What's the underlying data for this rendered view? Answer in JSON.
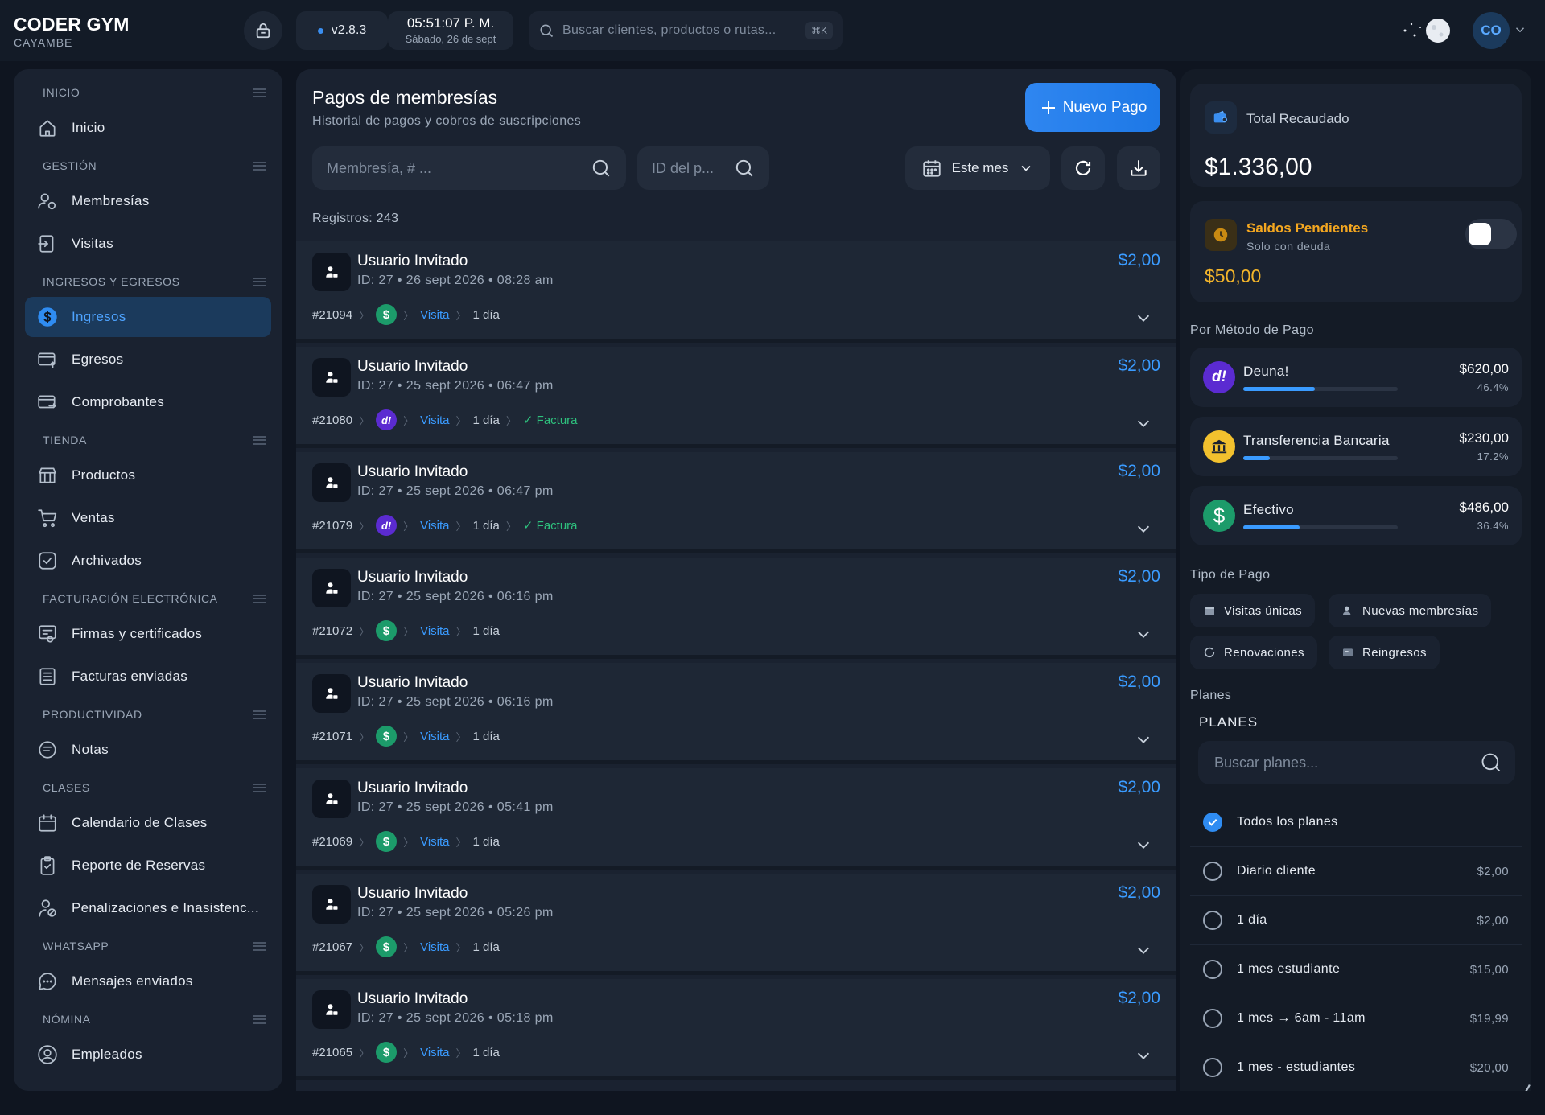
{
  "brand": {
    "name": "CODER GYM",
    "location": "CAYAMBE"
  },
  "topbar": {
    "version": "v2.8.3",
    "time": "05:51:07 P. M.",
    "date": "Sábado, 26 de sept",
    "search_placeholder": "Buscar clientes, productos o rutas...",
    "shortcut": "⌘K",
    "avatar_initials": "CO"
  },
  "sidebar": {
    "sections": [
      {
        "title": "INICIO",
        "items": [
          {
            "label": "Inicio",
            "icon": "home-icon"
          }
        ]
      },
      {
        "title": "GESTIÓN",
        "items": [
          {
            "label": "Membresías",
            "icon": "users-icon"
          },
          {
            "label": "Visitas",
            "icon": "login-icon"
          }
        ]
      },
      {
        "title": "INGRESOS Y EGRESOS",
        "items": [
          {
            "label": "Ingresos",
            "icon": "dollar-circle-icon",
            "active": true
          },
          {
            "label": "Egresos",
            "icon": "card-out-icon"
          },
          {
            "label": "Comprobantes",
            "icon": "card-swap-icon"
          }
        ]
      },
      {
        "title": "TIENDA",
        "items": [
          {
            "label": "Productos",
            "icon": "store-icon"
          },
          {
            "label": "Ventas",
            "icon": "cart-icon"
          },
          {
            "label": "Archivados",
            "icon": "archive-check-icon"
          }
        ]
      },
      {
        "title": "FACTURACIÓN ELECTRÓNICA",
        "items": [
          {
            "label": "Firmas y certificados",
            "icon": "certificate-icon"
          },
          {
            "label": "Facturas enviadas",
            "icon": "list-doc-icon"
          }
        ]
      },
      {
        "title": "PRODUCTIVIDAD",
        "items": [
          {
            "label": "Notas",
            "icon": "notes-icon"
          }
        ]
      },
      {
        "title": "CLASES",
        "items": [
          {
            "label": "Calendario de Clases",
            "icon": "calendar-icon"
          },
          {
            "label": "Reporte de Reservas",
            "icon": "clipboard-check-icon"
          },
          {
            "label": "Penalizaciones e Inasistenc...",
            "icon": "user-block-icon"
          }
        ]
      },
      {
        "title": "WHATSAPP",
        "items": [
          {
            "label": "Mensajes enviados",
            "icon": "chat-icon"
          }
        ]
      },
      {
        "title": "NÓMINA",
        "items": [
          {
            "label": "Empleados",
            "icon": "user-circle-icon"
          }
        ]
      }
    ]
  },
  "main": {
    "title": "Pagos de membresías",
    "subtitle": "Historial de pagos y cobros de suscripciones",
    "new_button": "Nuevo Pago",
    "filter_membership_placeholder": "Membresía, # ...",
    "filter_id_placeholder": "ID del p...",
    "period": "Este mes",
    "records": "Registros: 243",
    "rows": [
      {
        "name": "Usuario Invitado",
        "meta": "ID: 27 • 26 sept 2026 • 08:28 am",
        "amount": "$2,00",
        "code": "#21094",
        "method": "cash",
        "type": "Visita",
        "plan": "1 día",
        "invoice": ""
      },
      {
        "name": "Usuario Invitado",
        "meta": "ID: 27 • 25 sept 2026 • 06:47 pm",
        "amount": "$2,00",
        "code": "#21080",
        "method": "deuna",
        "type": "Visita",
        "plan": "1 día",
        "invoice": "✓ Factura"
      },
      {
        "name": "Usuario Invitado",
        "meta": "ID: 27 • 25 sept 2026 • 06:47 pm",
        "amount": "$2,00",
        "code": "#21079",
        "method": "deuna",
        "type": "Visita",
        "plan": "1 día",
        "invoice": "✓ Factura"
      },
      {
        "name": "Usuario Invitado",
        "meta": "ID: 27 • 25 sept 2026 • 06:16 pm",
        "amount": "$2,00",
        "code": "#21072",
        "method": "cash",
        "type": "Visita",
        "plan": "1 día",
        "invoice": ""
      },
      {
        "name": "Usuario Invitado",
        "meta": "ID: 27 • 25 sept 2026 • 06:16 pm",
        "amount": "$2,00",
        "code": "#21071",
        "method": "cash",
        "type": "Visita",
        "plan": "1 día",
        "invoice": ""
      },
      {
        "name": "Usuario Invitado",
        "meta": "ID: 27 • 25 sept 2026 • 05:41 pm",
        "amount": "$2,00",
        "code": "#21069",
        "method": "cash",
        "type": "Visita",
        "plan": "1 día",
        "invoice": ""
      },
      {
        "name": "Usuario Invitado",
        "meta": "ID: 27 • 25 sept 2026 • 05:26 pm",
        "amount": "$2,00",
        "code": "#21067",
        "method": "cash",
        "type": "Visita",
        "plan": "1 día",
        "invoice": ""
      },
      {
        "name": "Usuario Invitado",
        "meta": "ID: 27 • 25 sept 2026 • 05:18 pm",
        "amount": "$2,00",
        "code": "#21065",
        "method": "cash",
        "type": "Visita",
        "plan": "1 día",
        "invoice": ""
      }
    ]
  },
  "summary": {
    "total_label": "Total Recaudado",
    "total_value": "$1.336,00",
    "pending_label": "Saldos Pendientes",
    "pending_sub": "Solo con deuda",
    "pending_value": "$50,00",
    "pending_toggle_on": false,
    "by_method_title": "Por Método de Pago",
    "methods": [
      {
        "name": "Deuna!",
        "amount": "$620,00",
        "percent": "46.4%",
        "share": 0.464,
        "logo": "d!",
        "color": "#5b2bd1"
      },
      {
        "name": "Transferencia Bancaria",
        "amount": "$230,00",
        "percent": "17.2%",
        "share": 0.172,
        "logo": "bank-icon",
        "color": "#f2c12e"
      },
      {
        "name": "Efectivo",
        "amount": "$486,00",
        "percent": "36.4%",
        "share": 0.364,
        "logo": "$",
        "color": "#1c9b6a"
      }
    ],
    "type_title": "Tipo de Pago",
    "types": [
      "Visitas únicas",
      "Nuevas membresías",
      "Renovaciones",
      "Reingresos"
    ],
    "plans_title": "Planes",
    "plans_header": "PLANES",
    "plans_search_placeholder": "Buscar planes...",
    "plans": [
      {
        "name": "Todos los planes",
        "price": "",
        "checked": true
      },
      {
        "name": "Diario cliente",
        "price": "$2,00",
        "checked": false
      },
      {
        "name": "1 día",
        "price": "$2,00",
        "checked": false
      },
      {
        "name": "1 mes estudiante",
        "price": "$15,00",
        "checked": false
      },
      {
        "name": "1 mes → 6am - 11am",
        "price": "$19,99",
        "checked": false
      },
      {
        "name": "1 mes - estudiantes",
        "price": "$20,00",
        "checked": false
      }
    ]
  },
  "colors": {
    "accent": "#3a9bff",
    "warning": "#f4a720",
    "success": "#2ec27e",
    "background": "#0f1520"
  }
}
